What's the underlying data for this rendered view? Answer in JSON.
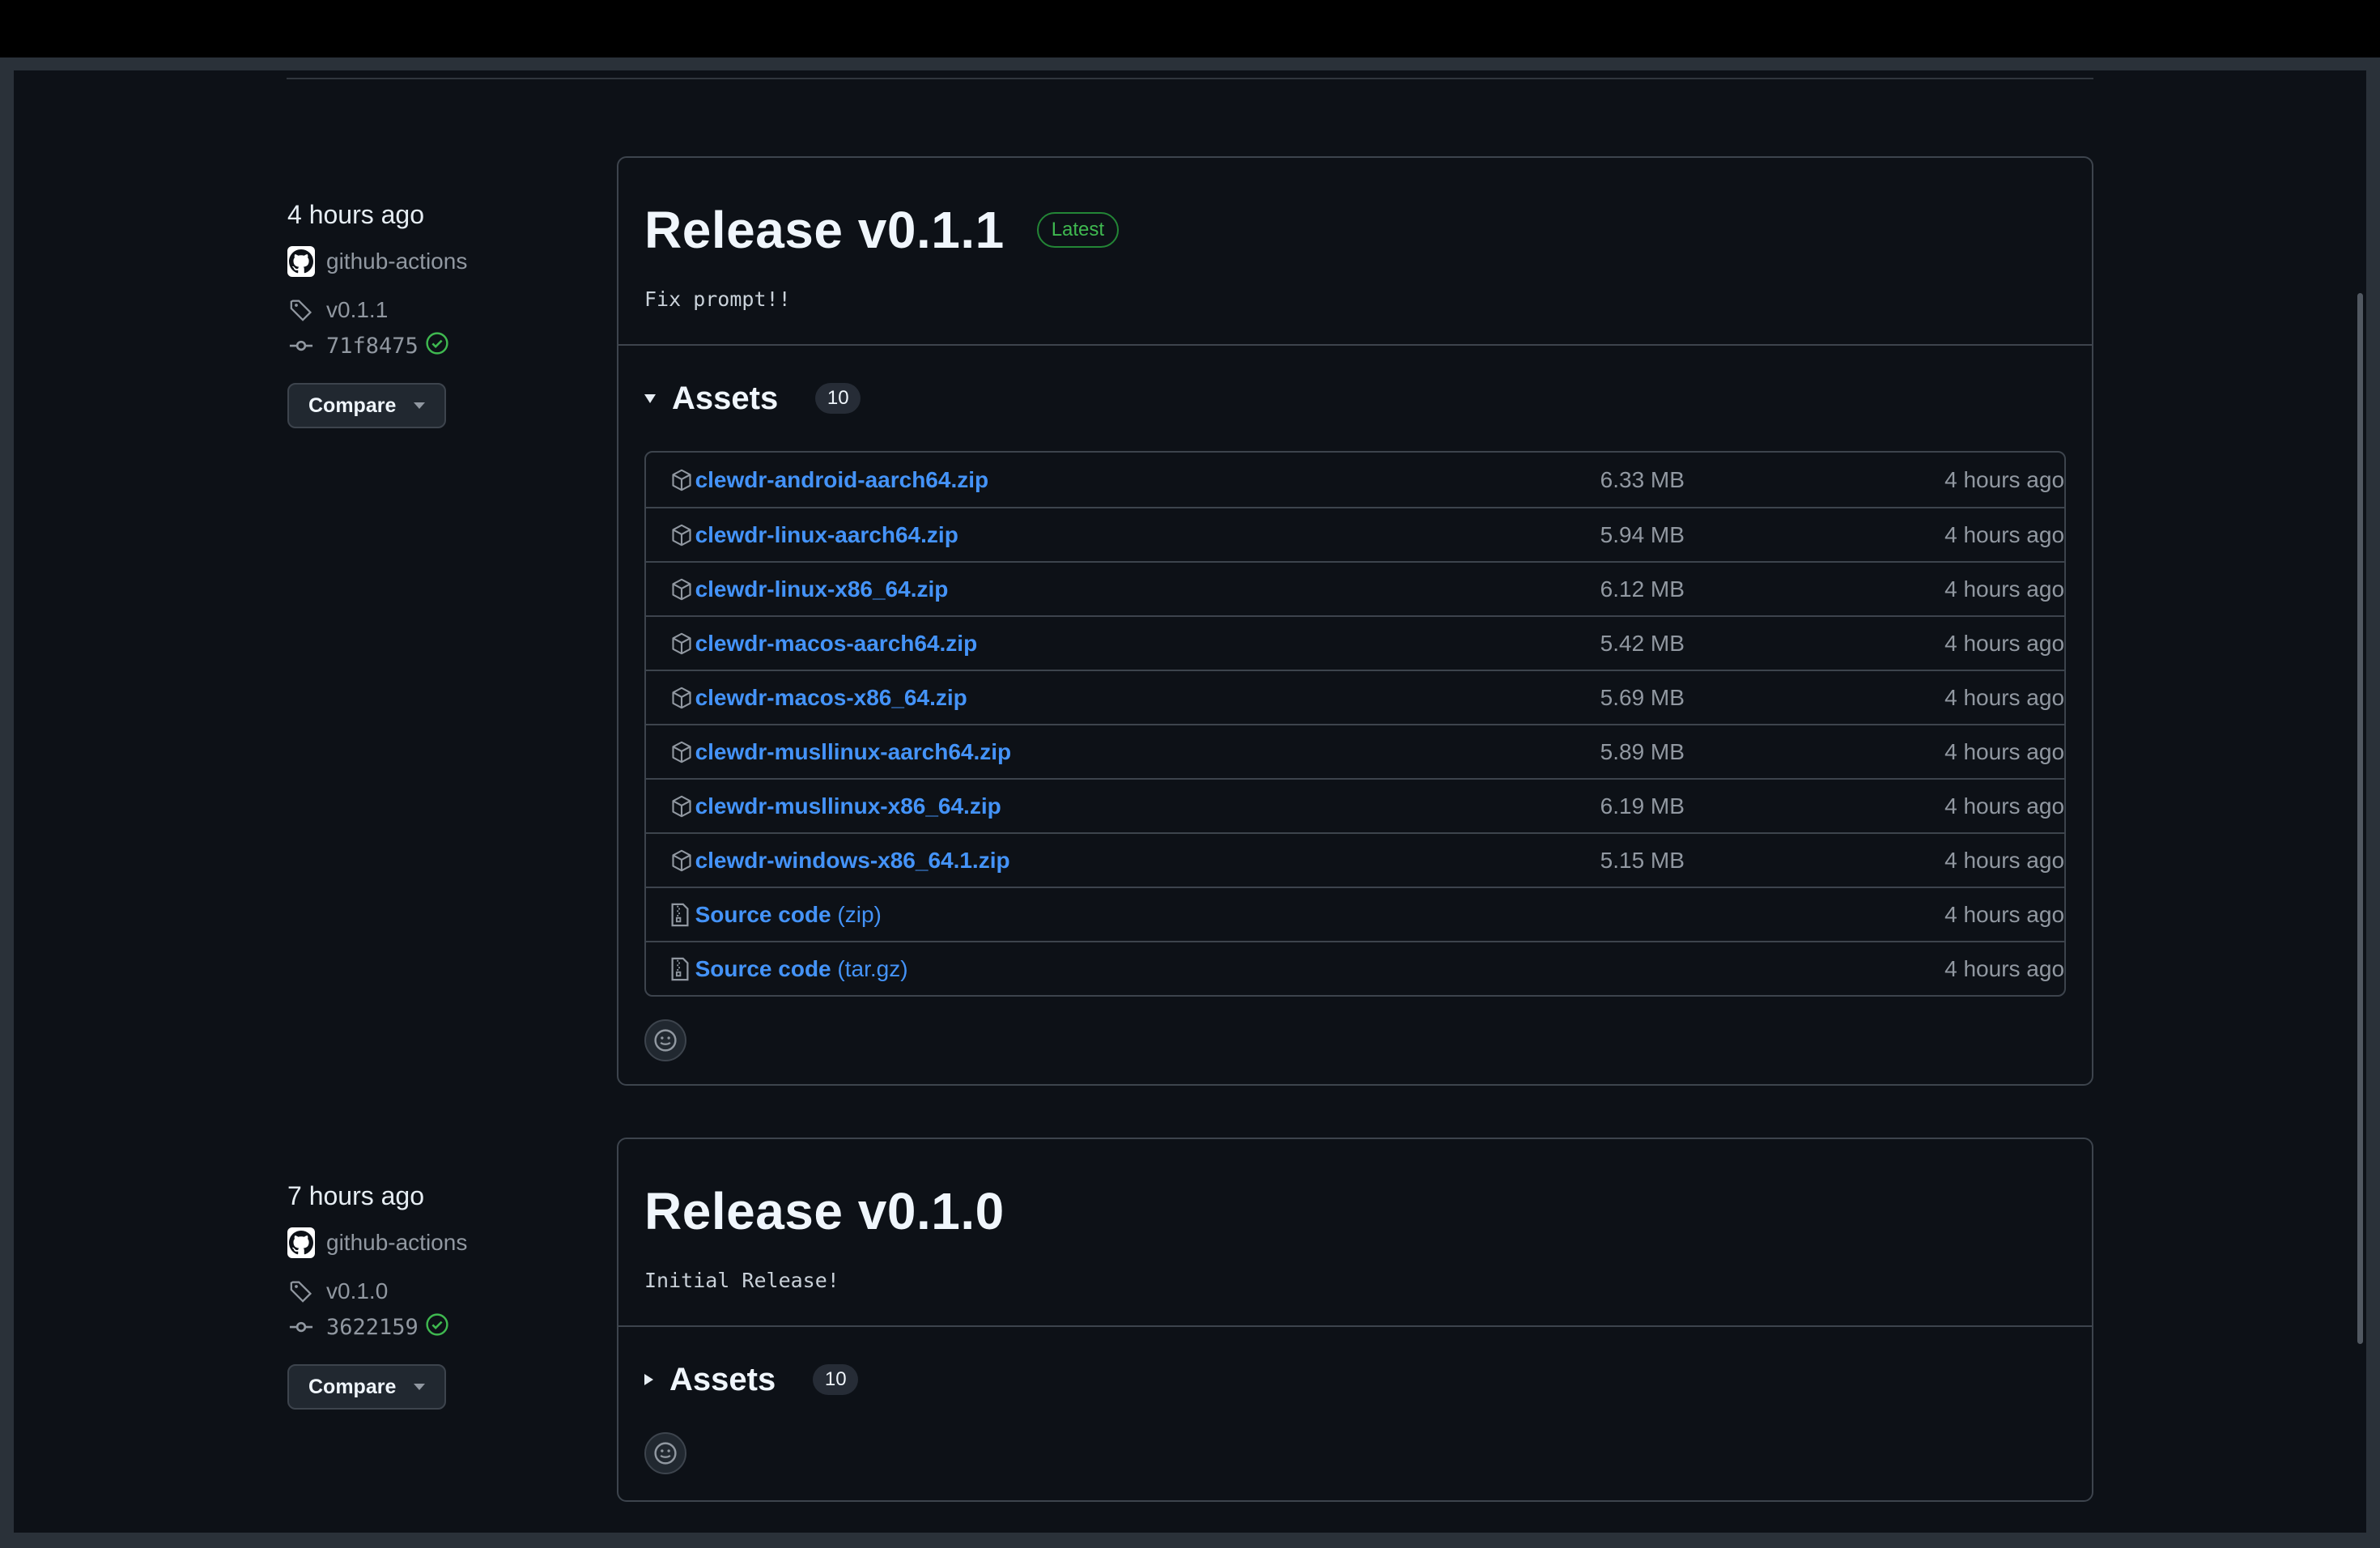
{
  "releases": [
    {
      "time_ago": "4 hours ago",
      "author": "github-actions",
      "tag": "v0.1.1",
      "commit": "71f8475",
      "compare_label": "Compare",
      "title": "Release v0.1.1",
      "badge": "Latest",
      "body": "Fix prompt!!",
      "assets_label": "Assets",
      "assets_count": "10",
      "assets_expanded": true,
      "assets": [
        {
          "name": "clewdr-android-aarch64.zip",
          "size": "6.33 MB",
          "time": "4 hours ago",
          "icon": "package-icon"
        },
        {
          "name": "clewdr-linux-aarch64.zip",
          "size": "5.94 MB",
          "time": "4 hours ago",
          "icon": "package-icon"
        },
        {
          "name": "clewdr-linux-x86_64.zip",
          "size": "6.12 MB",
          "time": "4 hours ago",
          "icon": "package-icon"
        },
        {
          "name": "clewdr-macos-aarch64.zip",
          "size": "5.42 MB",
          "time": "4 hours ago",
          "icon": "package-icon"
        },
        {
          "name": "clewdr-macos-x86_64.zip",
          "size": "5.69 MB",
          "time": "4 hours ago",
          "icon": "package-icon"
        },
        {
          "name": "clewdr-musllinux-aarch64.zip",
          "size": "5.89 MB",
          "time": "4 hours ago",
          "icon": "package-icon"
        },
        {
          "name": "clewdr-musllinux-x86_64.zip",
          "size": "6.19 MB",
          "time": "4 hours ago",
          "icon": "package-icon"
        },
        {
          "name": "clewdr-windows-x86_64.1.zip",
          "size": "5.15 MB",
          "time": "4 hours ago",
          "icon": "package-icon"
        },
        {
          "name": "Source code",
          "suffix": "(zip)",
          "size": "",
          "time": "4 hours ago",
          "icon": "file-zip-icon"
        },
        {
          "name": "Source code",
          "suffix": "(tar.gz)",
          "size": "",
          "time": "4 hours ago",
          "icon": "file-zip-icon"
        }
      ]
    },
    {
      "time_ago": "7 hours ago",
      "author": "github-actions",
      "tag": "v0.1.0",
      "commit": "3622159",
      "compare_label": "Compare",
      "title": "Release v0.1.0",
      "badge": "",
      "body": "Initial Release!",
      "assets_label": "Assets",
      "assets_count": "10",
      "assets_expanded": false
    }
  ],
  "colors": {
    "background": "#0d1117",
    "link": "#4493f8",
    "border": "#3d444d",
    "success": "#3fb950"
  }
}
